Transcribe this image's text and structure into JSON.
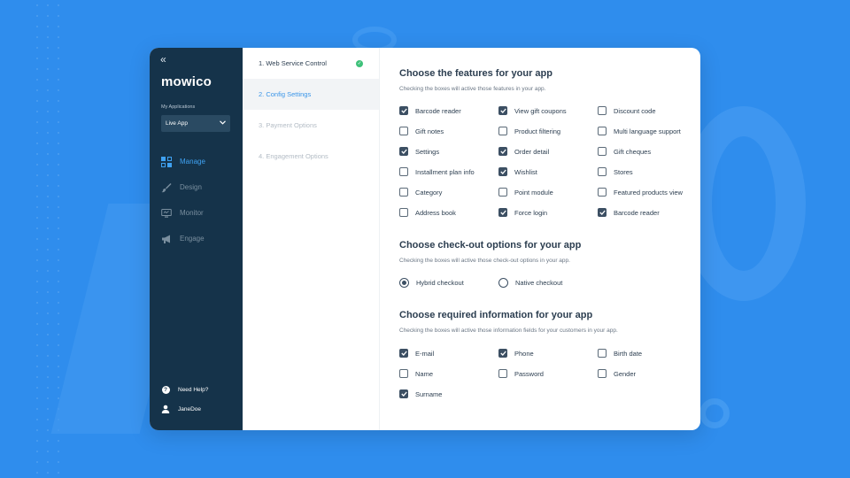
{
  "sidebar": {
    "collapse_glyph": "«",
    "logo": "mowico",
    "apps_label": "My Applications",
    "app_selected": "Live App",
    "nav": [
      {
        "label": "Manage",
        "icon": "grid-icon",
        "active": true
      },
      {
        "label": "Design",
        "icon": "brush-icon",
        "active": false
      },
      {
        "label": "Monitor",
        "icon": "monitor-icon",
        "active": false
      },
      {
        "label": "Engage",
        "icon": "megaphone-icon",
        "active": false
      }
    ],
    "help": "Need Help?",
    "user": "JaneDoe"
  },
  "steps": [
    {
      "label": "1. Web Service Control",
      "state": "done"
    },
    {
      "label": "2. Config Settings",
      "state": "current"
    },
    {
      "label": "3. Payment Options",
      "state": "pending"
    },
    {
      "label": "4. Engagement Options",
      "state": "pending"
    }
  ],
  "features": {
    "title": "Choose the features for your app",
    "desc": "Checking the boxes will active those features in your app.",
    "options": [
      {
        "label": "Barcode reader",
        "checked": true
      },
      {
        "label": "View gift coupons",
        "checked": true
      },
      {
        "label": "Discount code",
        "checked": false
      },
      {
        "label": "Gift notes",
        "checked": false
      },
      {
        "label": "Product filtering",
        "checked": false
      },
      {
        "label": "Multi language support",
        "checked": false
      },
      {
        "label": "Settings",
        "checked": true
      },
      {
        "label": "Order detail",
        "checked": true
      },
      {
        "label": "Gift cheques",
        "checked": false
      },
      {
        "label": "Installment plan info",
        "checked": false
      },
      {
        "label": "Wishlist",
        "checked": true
      },
      {
        "label": "Stores",
        "checked": false
      },
      {
        "label": "Category",
        "checked": false
      },
      {
        "label": "Point module",
        "checked": false
      },
      {
        "label": "Featured products view",
        "checked": false
      },
      {
        "label": "Address book",
        "checked": false
      },
      {
        "label": "Force login",
        "checked": true
      },
      {
        "label": "Barcode reader",
        "checked": true
      }
    ]
  },
  "checkout": {
    "title": "Choose check-out options for your app",
    "desc": "Checking the boxes will active those check-out options in your app.",
    "options": [
      {
        "label": "Hybrid checkout",
        "checked": true
      },
      {
        "label": "Native checkout",
        "checked": false
      }
    ]
  },
  "required": {
    "title": "Choose required information for your app",
    "desc": "Checking the boxes will active those information fields for your customers in your app.",
    "options": [
      {
        "label": "E-mail",
        "checked": true
      },
      {
        "label": "Phone",
        "checked": true
      },
      {
        "label": "Birth date",
        "checked": false
      },
      {
        "label": "Name",
        "checked": false
      },
      {
        "label": "Password",
        "checked": false
      },
      {
        "label": "Gender",
        "checked": false
      },
      {
        "label": "Surname",
        "checked": true
      }
    ]
  },
  "colors": {
    "background": "#2f8ded",
    "sidebar": "#15334a",
    "accent": "#3a95e8",
    "success": "#3fc17a",
    "checkbox": "#3c4f63"
  }
}
